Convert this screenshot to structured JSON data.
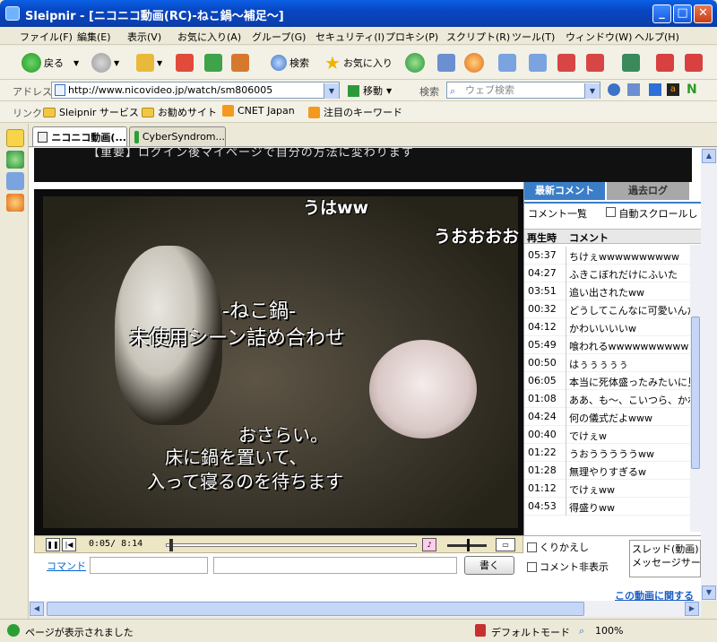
{
  "window": {
    "title": "Sleipnir - [ニコニコ動画(RC)-ねこ鍋～補足～]"
  },
  "menu": [
    "ファイル(F)",
    "編集(E)",
    "表示(V)",
    "お気に入り(A)",
    "グループ(G)",
    "セキュリティ(I)",
    "プロキシ(P)",
    "スクリプト(R)",
    "ツール(T)",
    "ウィンドウ(W)",
    "ヘルプ(H)"
  ],
  "toolbar": {
    "back": "戻る",
    "search": "検索",
    "favorites": "お気に入り"
  },
  "address": {
    "label": "アドレス",
    "url": "http://www.nicovideo.jp/watch/sm806005",
    "go": "移動",
    "search_label": "検索",
    "search_placeholder": "ウェブ検索"
  },
  "links": {
    "label": "リンク",
    "items": [
      "Sleipnir サービス",
      "お勧めサイト",
      "CNET Japan",
      "注目のキーワード"
    ]
  },
  "tabs": [
    {
      "label": "ニコニコ動画(..."
    },
    {
      "label": "CyberSyndrom..."
    }
  ],
  "banner": {
    "text": "【重要】ログイン後マイページで自分の方法に変わります"
  },
  "video": {
    "captions": [
      "-ねこ鍋-",
      "未使用シーン詰め合わせ",
      "おさらい。",
      "床に鍋を置いて、",
      "入って寝るのを待ちます"
    ],
    "danmaku": [
      "うはww",
      "うおおおお"
    ],
    "time": "0:05/ 8:14",
    "progress": 0.01
  },
  "command": {
    "label": "コマンド",
    "submit": "書く"
  },
  "comment_panel": {
    "tab_latest": "最新コメント",
    "tab_past": "過去ログ",
    "list_label": "コメント一覧",
    "autoscroll": "自動スクロールし",
    "col_time": "再生時",
    "col_comment": "コメント",
    "rows": [
      {
        "time": "05:37",
        "text": "ちけぇwwwwwwwwww"
      },
      {
        "time": "04:27",
        "text": "ふきこぼれだけにふいた"
      },
      {
        "time": "03:51",
        "text": "追い出されたww"
      },
      {
        "time": "00:32",
        "text": "どうしてこんなに可愛いんだ"
      },
      {
        "time": "04:12",
        "text": "かわいいいいw"
      },
      {
        "time": "05:49",
        "text": "喰われるwwwwwwwwww"
      },
      {
        "time": "00:50",
        "text": "はぅぅぅぅぅ"
      },
      {
        "time": "06:05",
        "text": "本当に死体盛ったみたいに見"
      },
      {
        "time": "01:08",
        "text": "ああ、も～、こいつら、かわい"
      },
      {
        "time": "04:24",
        "text": "何の儀式だよwww"
      },
      {
        "time": "00:40",
        "text": "でけぇw"
      },
      {
        "time": "01:22",
        "text": "うおうううううww"
      },
      {
        "time": "01:28",
        "text": "無理やりすぎるw"
      },
      {
        "time": "01:12",
        "text": "でけぇww"
      },
      {
        "time": "04:53",
        "text": "得盛りww"
      }
    ],
    "repeat": "くりかえし",
    "hide_comments": "コメント非表示",
    "thread_info": [
      "スレッド(動画):",
      "メッセージサー"
    ]
  },
  "content": {
    "related_link": "この動画に関する"
  },
  "status": {
    "text": "ページが表示されました",
    "mode": "デフォルトモード",
    "zoom": "100%"
  },
  "colors": {
    "titlebar": "#0846c2",
    "comment_tab": "#3b7ec7"
  }
}
